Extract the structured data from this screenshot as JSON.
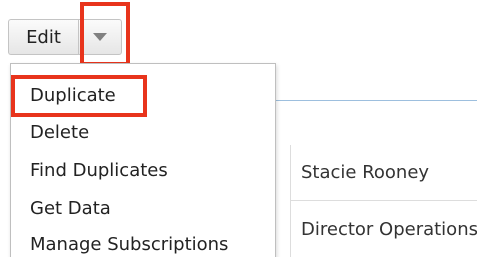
{
  "toolbar": {
    "edit_label": "Edit",
    "dropdown_icon": "chevron-down-icon"
  },
  "menu": {
    "items": [
      {
        "label": "Duplicate",
        "highlighted": true
      },
      {
        "label": "Delete"
      },
      {
        "label": "Find Duplicates"
      },
      {
        "label": "Get Data"
      },
      {
        "label": "Manage Subscriptions"
      }
    ]
  },
  "record": {
    "name": "Stacie Rooney",
    "title": "Director Operations"
  },
  "colors": {
    "highlight": "#e8341c",
    "separator": "#9dbfde"
  }
}
